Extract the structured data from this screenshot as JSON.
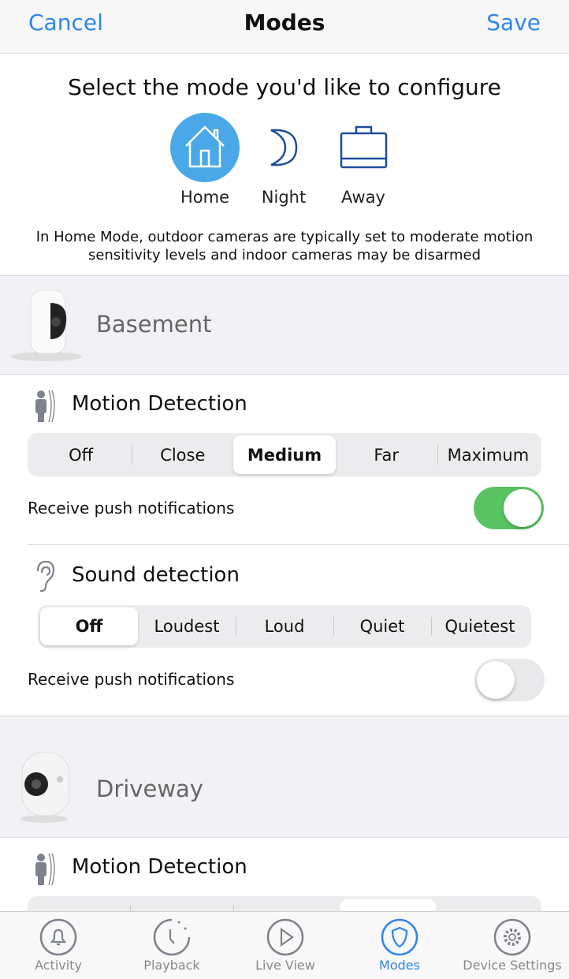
{
  "nav": {
    "cancel": "Cancel",
    "title": "Modes",
    "save": "Save"
  },
  "mode_picker": {
    "prompt": "Select the mode you'd like to configure",
    "modes": [
      {
        "label": "Home",
        "icon": "house-icon",
        "selected": true
      },
      {
        "label": "Night",
        "icon": "moon-icon",
        "selected": false
      },
      {
        "label": "Away",
        "icon": "briefcase-icon",
        "selected": false
      }
    ],
    "description": "In Home Mode, outdoor cameras are typically set to moderate motion sensitivity levels and indoor cameras may be disarmed"
  },
  "colors": {
    "accent": "#2f86e8",
    "mode_selected": "#4aa8e8",
    "toggle_on": "#5ac463",
    "icon_blue": "#1f4e9c"
  },
  "cameras": [
    {
      "name": "Basement",
      "motion": {
        "title": "Motion Detection",
        "options": [
          "Off",
          "Close",
          "Medium",
          "Far",
          "Maximum"
        ],
        "selected": "Medium",
        "push_label": "Receive push notifications",
        "push_on": true
      },
      "sound": {
        "title": "Sound detection",
        "options": [
          "Off",
          "Loudest",
          "Loud",
          "Quiet",
          "Quietest"
        ],
        "selected": "Off",
        "push_label": "Receive push notifications",
        "push_on": false
      }
    },
    {
      "name": "Driveway",
      "motion": {
        "title": "Motion Detection"
      }
    }
  ],
  "tabs": [
    {
      "label": "Activity",
      "icon": "bell-icon"
    },
    {
      "label": "Playback",
      "icon": "clock-icon"
    },
    {
      "label": "Live View",
      "icon": "play-icon"
    },
    {
      "label": "Modes",
      "icon": "shield-icon",
      "active": true
    },
    {
      "label": "Device Settings",
      "icon": "gear-icon"
    }
  ]
}
